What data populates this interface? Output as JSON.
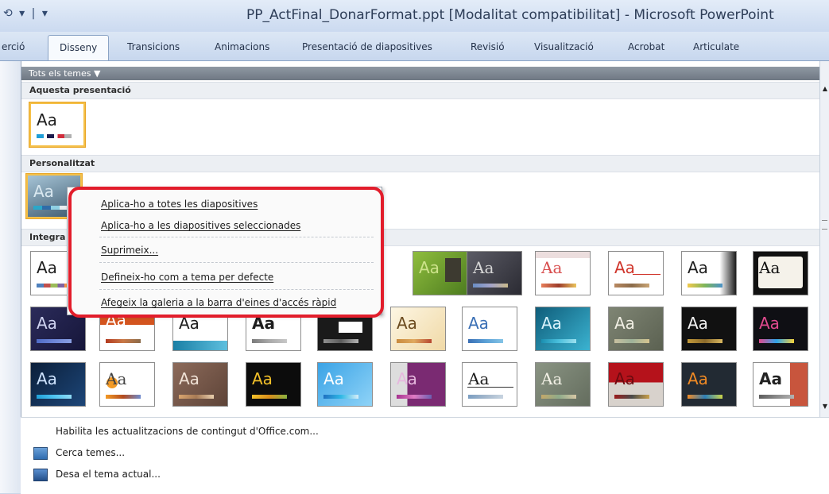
{
  "window": {
    "title": "PP_ActFinal_DonarFormat.ppt [Modalitat compatibilitat]  -  Microsoft PowerPoint",
    "qat": "⟲ ▾ | ▾"
  },
  "ribbon_tabs": [
    {
      "label": "erció"
    },
    {
      "label": "Disseny",
      "active": true
    },
    {
      "label": "Transicions"
    },
    {
      "label": "Animacions"
    },
    {
      "label": "Presentació de diapositives"
    },
    {
      "label": "Revisió"
    },
    {
      "label": "Visualització"
    },
    {
      "label": "Acrobat"
    },
    {
      "label": "Articulate"
    }
  ],
  "gallery": {
    "filter_label": "Tots els temes ▼",
    "section_this": "Aquesta presentació",
    "section_custom": "Personalitzat",
    "section_builtin": "Integra",
    "thumb_text": "Aa"
  },
  "context_menu": {
    "items": [
      "Aplica-ho a totes les diapositives",
      "Aplica-ho a les diapositives seleccionades",
      "Suprimeix...",
      "Defineix-ho com a tema per defecte",
      "Afegeix la galeria a la barra d'eines d'accés ràpid"
    ]
  },
  "footer": {
    "items": [
      "Habilita les actualitzacions de contingut d'Office.com...",
      "Cerca temes...",
      "Desa el tema actual..."
    ]
  },
  "colors": {
    "highlight_ring": "#e21d2b",
    "selected_border": "#f5c048"
  }
}
